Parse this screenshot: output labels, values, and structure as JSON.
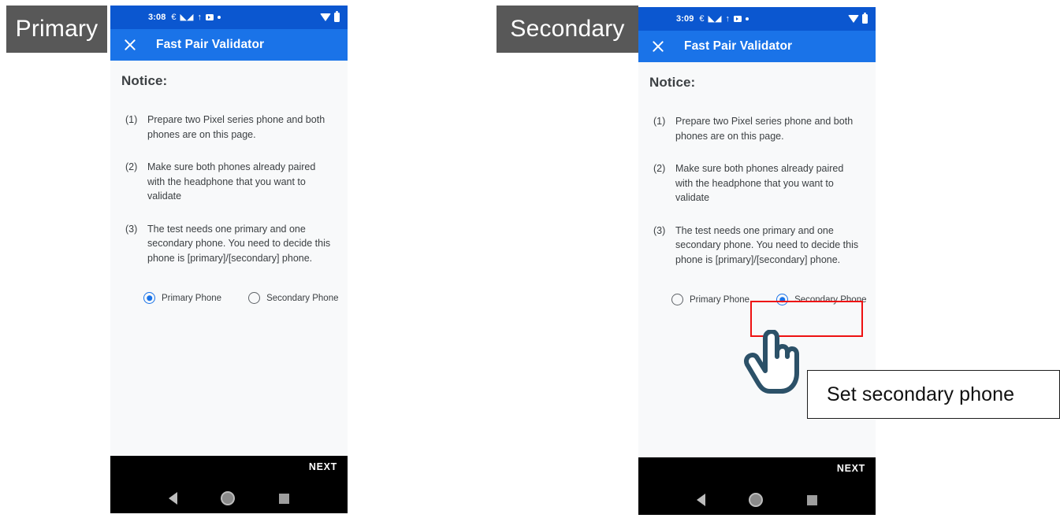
{
  "annotations": {
    "primary_label": "Primary",
    "secondary_label": "Secondary",
    "callout_text": "Set secondary phone",
    "highlight_color": "#ee1111",
    "cursor_icon": "pointing-hand-cursor",
    "cursor_stroke_color": "#2c5168"
  },
  "theme": {
    "status_bar_color": "#0b57d0",
    "app_bar_color": "#1a73e8",
    "accent_color": "#1a73e8",
    "content_bg": "#f8f9fa",
    "nav_bar_color": "#000000",
    "label_chip_color": "#585858"
  },
  "phones": [
    {
      "id": "primary",
      "status_bar": {
        "clock": "3:08",
        "icons": [
          "sim-icon",
          "gmail-icon",
          "maps-icon",
          "youtube-icon",
          "more-dot-icon"
        ],
        "right_icons": [
          "wifi-icon",
          "battery-icon"
        ]
      },
      "app_bar": {
        "close_icon": "close-icon",
        "title": "Fast Pair Validator"
      },
      "content": {
        "notice_title": "Notice:",
        "items": [
          {
            "num": "(1)",
            "text": "Prepare two Pixel series phone and both phones are on this page."
          },
          {
            "num": "(2)",
            "text": "Make sure both phones already paired with the headphone that you want to validate"
          },
          {
            "num": "(3)",
            "text": "The test needs one primary and one secondary phone. You need to decide this phone is [primary]/[secondary] phone."
          }
        ],
        "radio_options": [
          {
            "label": "Primary Phone",
            "selected": true
          },
          {
            "label": "Secondary Phone",
            "selected": false
          }
        ]
      },
      "bottom": {
        "next_label": "NEXT",
        "nav_icons": [
          "back-icon",
          "home-icon",
          "recents-icon"
        ]
      }
    },
    {
      "id": "secondary",
      "status_bar": {
        "clock": "3:09",
        "icons": [
          "sim-icon",
          "gmail-icon",
          "maps-icon",
          "youtube-icon",
          "more-dot-icon"
        ],
        "right_icons": [
          "wifi-icon",
          "battery-icon"
        ]
      },
      "app_bar": {
        "close_icon": "close-icon",
        "title": "Fast Pair Validator"
      },
      "content": {
        "notice_title": "Notice:",
        "items": [
          {
            "num": "(1)",
            "text": "Prepare two Pixel series phone and both phones are on this page."
          },
          {
            "num": "(2)",
            "text": "Make sure both phones already paired with the headphone that you want to validate"
          },
          {
            "num": "(3)",
            "text": "The test needs one primary and one secondary phone. You need to decide this phone is [primary]/[secondary] phone."
          }
        ],
        "radio_options": [
          {
            "label": "Primary Phone",
            "selected": false
          },
          {
            "label": "Secondary Phone",
            "selected": true
          }
        ]
      },
      "bottom": {
        "next_label": "NEXT",
        "nav_icons": [
          "back-icon",
          "home-icon",
          "recents-icon"
        ]
      }
    }
  ]
}
